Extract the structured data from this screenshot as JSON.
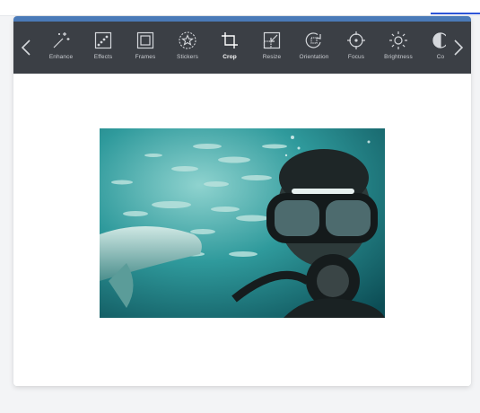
{
  "colors": {
    "accent": "#4a7ab8",
    "toolbar_bg": "#3b3f45",
    "icon": "#d5d8dc",
    "link": "#2f56d8"
  },
  "toolbar": {
    "prev_icon": "chevron-left-icon",
    "next_icon": "chevron-right-icon",
    "tools": [
      {
        "label": "Enhance",
        "icon": "magic-wand-icon"
      },
      {
        "label": "Effects",
        "icon": "effects-icon"
      },
      {
        "label": "Frames",
        "icon": "frame-icon"
      },
      {
        "label": "Stickers",
        "icon": "sticker-star-icon"
      },
      {
        "label": "Crop",
        "icon": "crop-icon",
        "active": true
      },
      {
        "label": "Resize",
        "icon": "resize-icon"
      },
      {
        "label": "Orientation",
        "icon": "rotate-icon"
      },
      {
        "label": "Focus",
        "icon": "focus-icon"
      },
      {
        "label": "Brightness",
        "icon": "brightness-icon"
      },
      {
        "label": "Co",
        "icon": "contrast-icon"
      }
    ]
  },
  "canvas": {
    "image_subject": "underwater-diver-selfie-photo"
  }
}
